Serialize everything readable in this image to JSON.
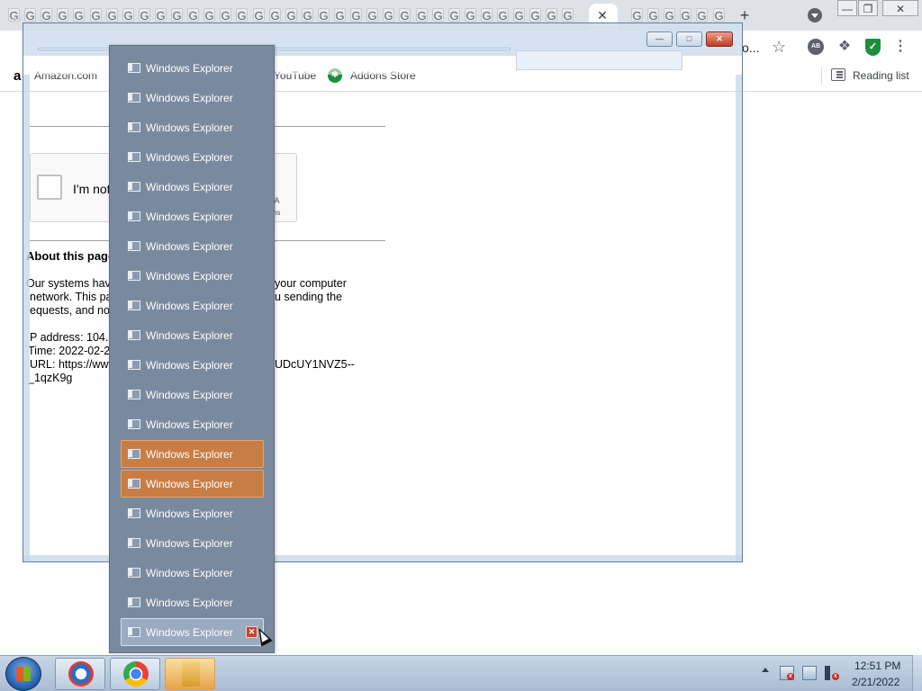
{
  "browser": {
    "tab_favicon_letter": "G",
    "tab_close_glyph": "✕",
    "new_tab_glyph": "+",
    "address_partial": "o...",
    "bookmarks": [
      {
        "label": "Amazon.com",
        "icon": "amazon-icon"
      },
      {
        "label": "YouTube",
        "icon": "youtube-icon"
      },
      {
        "label": "Addons Store",
        "icon": "addons-store-icon"
      }
    ],
    "reading_list": "Reading list"
  },
  "page": {
    "captcha_label": "I'm not",
    "captcha_brand": "HA",
    "captcha_terms": "rms",
    "about_heading": "About this page",
    "lines": [
      "Our systems hav",
      "network. This pa",
      "equests, and no",
      "P address: 104.",
      "Time: 2022-02-2",
      "URL: https://www",
      "_1qzK9g"
    ],
    "lines_right": [
      "your computer",
      "u sending the",
      "UDcUY1NVZ5--"
    ]
  },
  "jumplist": {
    "items": [
      {
        "label": "Windows Explorer"
      },
      {
        "label": "Windows Explorer"
      },
      {
        "label": "Windows Explorer"
      },
      {
        "label": "Windows Explorer"
      },
      {
        "label": "Windows Explorer"
      },
      {
        "label": "Windows Explorer"
      },
      {
        "label": "Windows Explorer"
      },
      {
        "label": "Windows Explorer"
      },
      {
        "label": "Windows Explorer"
      },
      {
        "label": "Windows Explorer"
      },
      {
        "label": "Windows Explorer"
      },
      {
        "label": "Windows Explorer"
      },
      {
        "label": "Windows Explorer"
      },
      {
        "label": "Windows Explorer",
        "state": "highlighted"
      },
      {
        "label": "Windows Explorer",
        "state": "highlighted"
      },
      {
        "label": "Windows Explorer"
      },
      {
        "label": "Windows Explorer"
      },
      {
        "label": "Windows Explorer"
      },
      {
        "label": "Windows Explorer"
      },
      {
        "label": "Windows Explorer",
        "state": "hover"
      }
    ]
  },
  "taskbar": {
    "clock_time": "12:51 PM",
    "clock_date": "2/21/2022",
    "items": [
      {
        "name": "vpn-app-icon",
        "active": false
      },
      {
        "name": "chrome-icon",
        "active": false
      },
      {
        "name": "windows-explorer-icon",
        "active": true
      }
    ]
  },
  "colors": {
    "jumplist_bg": "#7a8a9e",
    "highlight": "#c87d45",
    "taskbar": "#b9cbde",
    "chrome_tabstrip": "#dee1e6"
  }
}
